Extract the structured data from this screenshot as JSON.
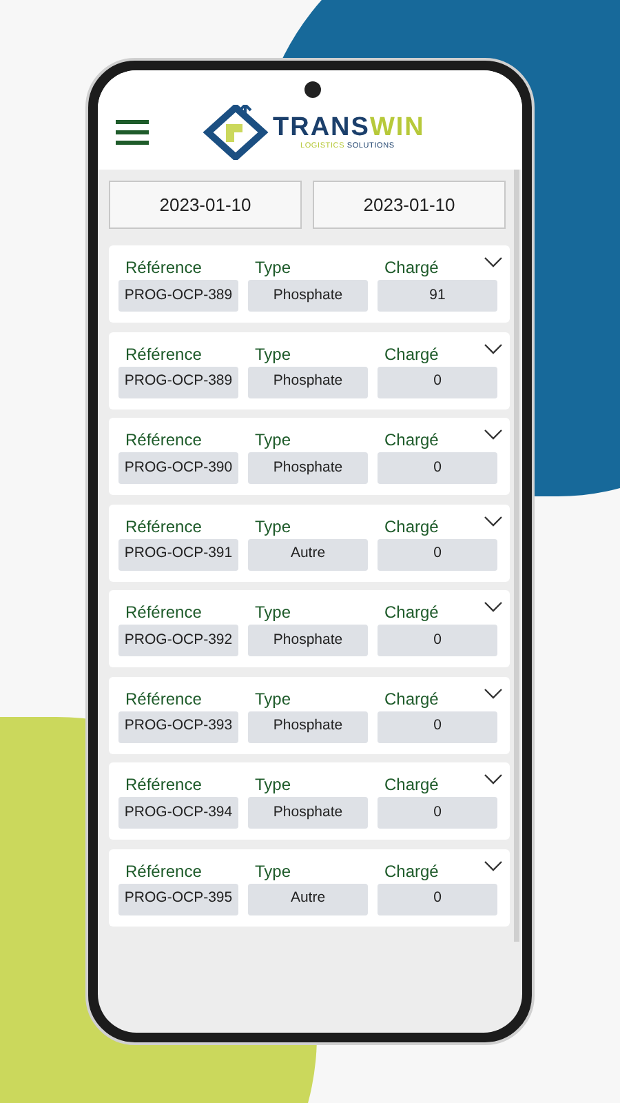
{
  "header": {
    "logo": {
      "name_main": "TRANS",
      "name_accent": "WIN",
      "tagline_accent": "LOGISTICS",
      "tagline_main": "SOLUTIONS"
    }
  },
  "filters": {
    "date_from": "2023-01-10",
    "date_to": "2023-01-10"
  },
  "rows": [
    {
      "labels": [
        "Référence",
        "Type",
        "Chargé"
      ],
      "reference": "PROG-OCP-389",
      "type": "Phosphate",
      "charged": "91",
      "expanded": false
    },
    {
      "labels": [
        "Référence",
        "Type",
        "Chargé"
      ],
      "reference": "PROG-OCP-389",
      "type": "Phosphate",
      "charged": "0",
      "expanded": false
    },
    {
      "labels": [
        "Référence",
        "Type",
        "Chargé"
      ],
      "reference": "PROG-OCP-390",
      "type": "Phosphate",
      "charged": "0",
      "expanded": false
    },
    {
      "labels": [
        "Référence",
        "Type",
        "Chargé"
      ],
      "reference": "PROG-OCP-391",
      "type": "Autre",
      "charged": "0",
      "expanded": false
    },
    {
      "labels": [
        "Référence",
        "Type",
        "Chargé"
      ],
      "reference": "PROG-OCP-392",
      "type": "Phosphate",
      "charged": "0",
      "expanded": false
    },
    {
      "labels": [
        "Référence",
        "Type",
        "Chargé"
      ],
      "reference": "PROG-OCP-393",
      "type": "Phosphate",
      "charged": "0",
      "expanded": false
    },
    {
      "labels": [
        "Référence",
        "Type",
        "Chargé"
      ],
      "reference": "PROG-OCP-394",
      "type": "Phosphate",
      "charged": "0",
      "expanded": false
    },
    {
      "labels": [
        "Référence",
        "Type",
        "Chargé"
      ],
      "reference": "PROG-OCP-395",
      "type": "Autre",
      "charged": "0",
      "expanded": false
    }
  ]
}
